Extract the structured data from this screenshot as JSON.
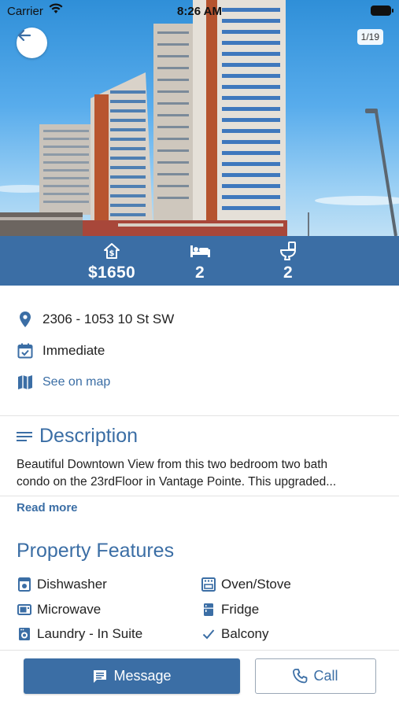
{
  "status_bar": {
    "carrier": "Carrier",
    "time": "8:26 AM"
  },
  "gallery": {
    "counter": "1/19"
  },
  "stats": {
    "price": "$1650",
    "price_icon": "home-dollar-icon",
    "bedrooms": "2",
    "bedrooms_icon": "bed-icon",
    "bathrooms": "2",
    "bathrooms_icon": "toilet-icon"
  },
  "details": {
    "address": "2306 - 1053 10 St SW",
    "availability": "Immediate",
    "map_link": "See on map"
  },
  "description": {
    "title": "Description",
    "line1": "Beautiful Downtown View from this two bedroom two bath",
    "line2": "condo on the 23rdFloor in Vantage Pointe. This upgraded...",
    "read_more": "Read more"
  },
  "features": {
    "title": "Property Features",
    "items": [
      {
        "label": "Dishwasher",
        "icon": "dishwasher-icon"
      },
      {
        "label": "Oven/Stove",
        "icon": "stove-icon"
      },
      {
        "label": "Microwave",
        "icon": "microwave-icon"
      },
      {
        "label": "Fridge",
        "icon": "fridge-icon"
      },
      {
        "label": "Laundry - In Suite",
        "icon": "washer-icon"
      },
      {
        "label": "Balcony",
        "icon": "check-icon"
      }
    ]
  },
  "actions": {
    "message": "Message",
    "call": "Call"
  },
  "colors": {
    "accent": "#3b6ea5",
    "divider": "#e3e3e3"
  }
}
